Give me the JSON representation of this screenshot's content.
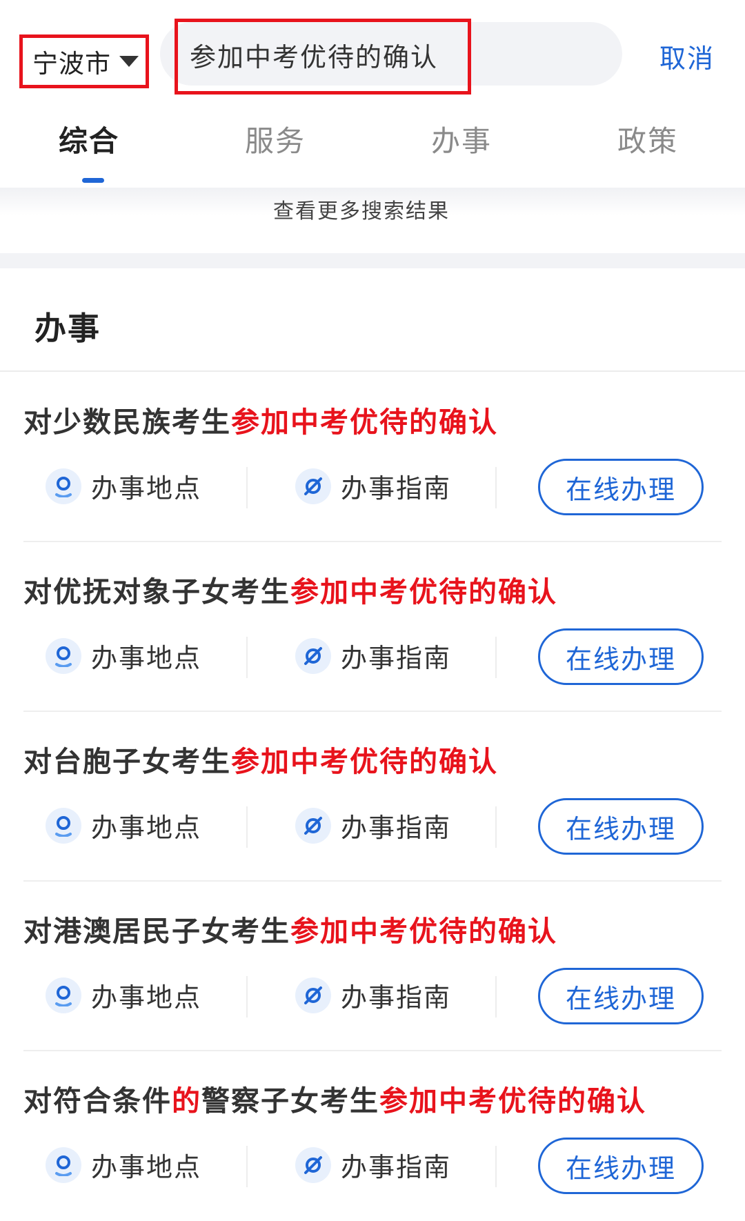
{
  "header": {
    "city": "宁波市",
    "search_value": "参加中考优待的确认",
    "cancel_label": "取消"
  },
  "tabs": [
    {
      "label": "综合",
      "active": true
    },
    {
      "label": "服务",
      "active": false
    },
    {
      "label": "办事",
      "active": false
    },
    {
      "label": "政策",
      "active": false
    }
  ],
  "more_results_label": "查看更多搜索结果",
  "section": {
    "title": "办事"
  },
  "results": [
    {
      "title_prefix": "对少数民族考生",
      "title_highlight": "参加中考优待的确认",
      "location_label": "办事地点",
      "guide_label": "办事指南",
      "online_label": "在线办理"
    },
    {
      "title_prefix": "对优抚对象子女考生",
      "title_highlight": "参加中考优待的确认",
      "location_label": "办事地点",
      "guide_label": "办事指南",
      "online_label": "在线办理"
    },
    {
      "title_prefix": "对台胞子女考生",
      "title_highlight": "参加中考优待的确认",
      "location_label": "办事地点",
      "guide_label": "办事指南",
      "online_label": "在线办理"
    },
    {
      "title_prefix": "对港澳居民子女考生",
      "title_highlight": "参加中考优待的确认",
      "location_label": "办事地点",
      "guide_label": "办事指南",
      "online_label": "在线办理"
    },
    {
      "title_prefix": "对符合条件",
      "title_mid_highlight": "的",
      "title_mid": "警察子女考生",
      "title_highlight": "参加中考优待的确认",
      "location_label": "办事地点",
      "guide_label": "办事指南",
      "online_label": "在线办理"
    }
  ],
  "icons": {
    "dropdown": "caret-down-icon",
    "location": "map-pin-icon",
    "guide": "compass-icon"
  },
  "colors": {
    "accent_blue": "#1f66d6",
    "highlight_red": "#e8131c",
    "annotation_red": "#e8131c"
  }
}
